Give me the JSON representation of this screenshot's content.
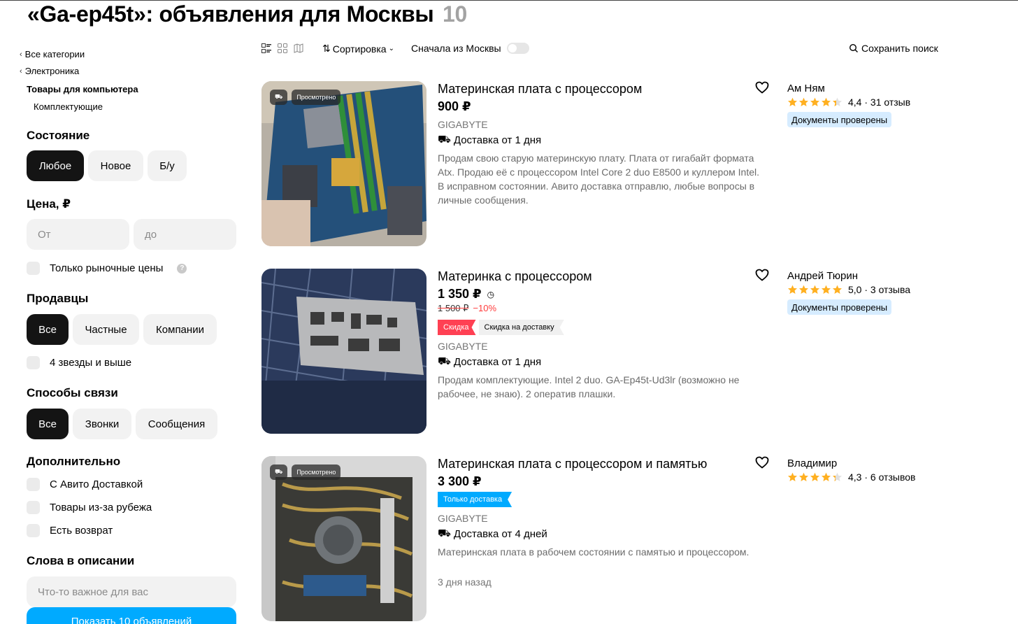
{
  "header": {
    "title": "«Ga-ep45t»: объявления для Москвы",
    "count": "10"
  },
  "sidebar": {
    "crumbs": [
      "Все категории",
      "Электроника"
    ],
    "current_category": "Товары для компьютера",
    "subcategory": "Комплектующие",
    "condition": {
      "title": "Состояние",
      "options": [
        "Любое",
        "Новое",
        "Б/у"
      ],
      "selected": "Любое"
    },
    "price": {
      "title": "Цена, ₽",
      "from_placeholder": "От",
      "to_placeholder": "до",
      "market_only_label": "Только рыночные цены",
      "help_icon": "?"
    },
    "sellers": {
      "title": "Продавцы",
      "options": [
        "Все",
        "Частные",
        "Компании"
      ],
      "selected": "Все",
      "stars_label": "4 звезды и выше"
    },
    "contact": {
      "title": "Способы связи",
      "options": [
        "Все",
        "Звонки",
        "Сообщения"
      ],
      "selected": "Все"
    },
    "extra": {
      "title": "Дополнительно",
      "options": [
        "С Авито Доставкой",
        "Товары из-за рубежа",
        "Есть возврат"
      ]
    },
    "words": {
      "title": "Слова в описании",
      "placeholder": "Что-то важное для вас"
    },
    "show_button": "Показать 10 объявлений"
  },
  "toolbar": {
    "view_icons": [
      "list-view-icon",
      "grid-view-icon",
      "map-view-icon"
    ],
    "sort_label": "Сортировка",
    "moscow_first_label": "Сначала из Москвы",
    "moscow_first_on": false,
    "save_search_label": "Сохранить поиск"
  },
  "listings": [
    {
      "title": "Материнская плата с процессором",
      "price": "900 ₽",
      "viewed_badge": "Просмотрено",
      "brand": "GIGABYTE",
      "delivery": "Доставка от 1 дня",
      "description": "Продам свою старую материнскую плату. Плата от гигабайт формата Atx. Продаю её с процессором Intel Core 2 duo E8500 и куллером Intel. В исправном состоянии. Авито доставка отправлю, любые вопросы в личные сообщения.",
      "seller": "Ам Ням",
      "rating": "4,4 · 31 отзыв",
      "stars": 4.4,
      "docs_badge": "Документы проверены"
    },
    {
      "title": "Материнка с процессором",
      "price": "1 350 ₽",
      "old_price": "1 500 ₽",
      "discount": "−10%",
      "tags": [
        "Скидка",
        "Скидка на доставку"
      ],
      "brand": "GIGABYTE",
      "delivery": "Доставка от 1 дня",
      "description": "Продам комплектующие. Intel 2 duo. GA-Ep45t-Ud3lr (возможно не рабочее, не знаю). 2 оператив плашки.",
      "seller": "Андрей Тюрин",
      "rating": "5,0 · 3 отзыва",
      "stars": 5.0,
      "docs_badge": "Документы проверены"
    },
    {
      "title": "Материнская плата с процессором и памятью",
      "price": "3 300 ₽",
      "viewed_badge": "Просмотрено",
      "tags": [
        "Только доставка"
      ],
      "brand": "GIGABYTE",
      "delivery": "Доставка от 4 дней",
      "description": "Материнская плата в рабочем состоянии с памятью и процессором.",
      "date": "3 дня назад",
      "seller": "Владимир",
      "rating": "4,3 · 6 отзывов",
      "stars": 4.3
    }
  ],
  "colors": {
    "accent_blue": "#00aaff",
    "discount_red": "#ff4053",
    "star": "#ffb021",
    "docs_bg": "#d6ecff"
  }
}
